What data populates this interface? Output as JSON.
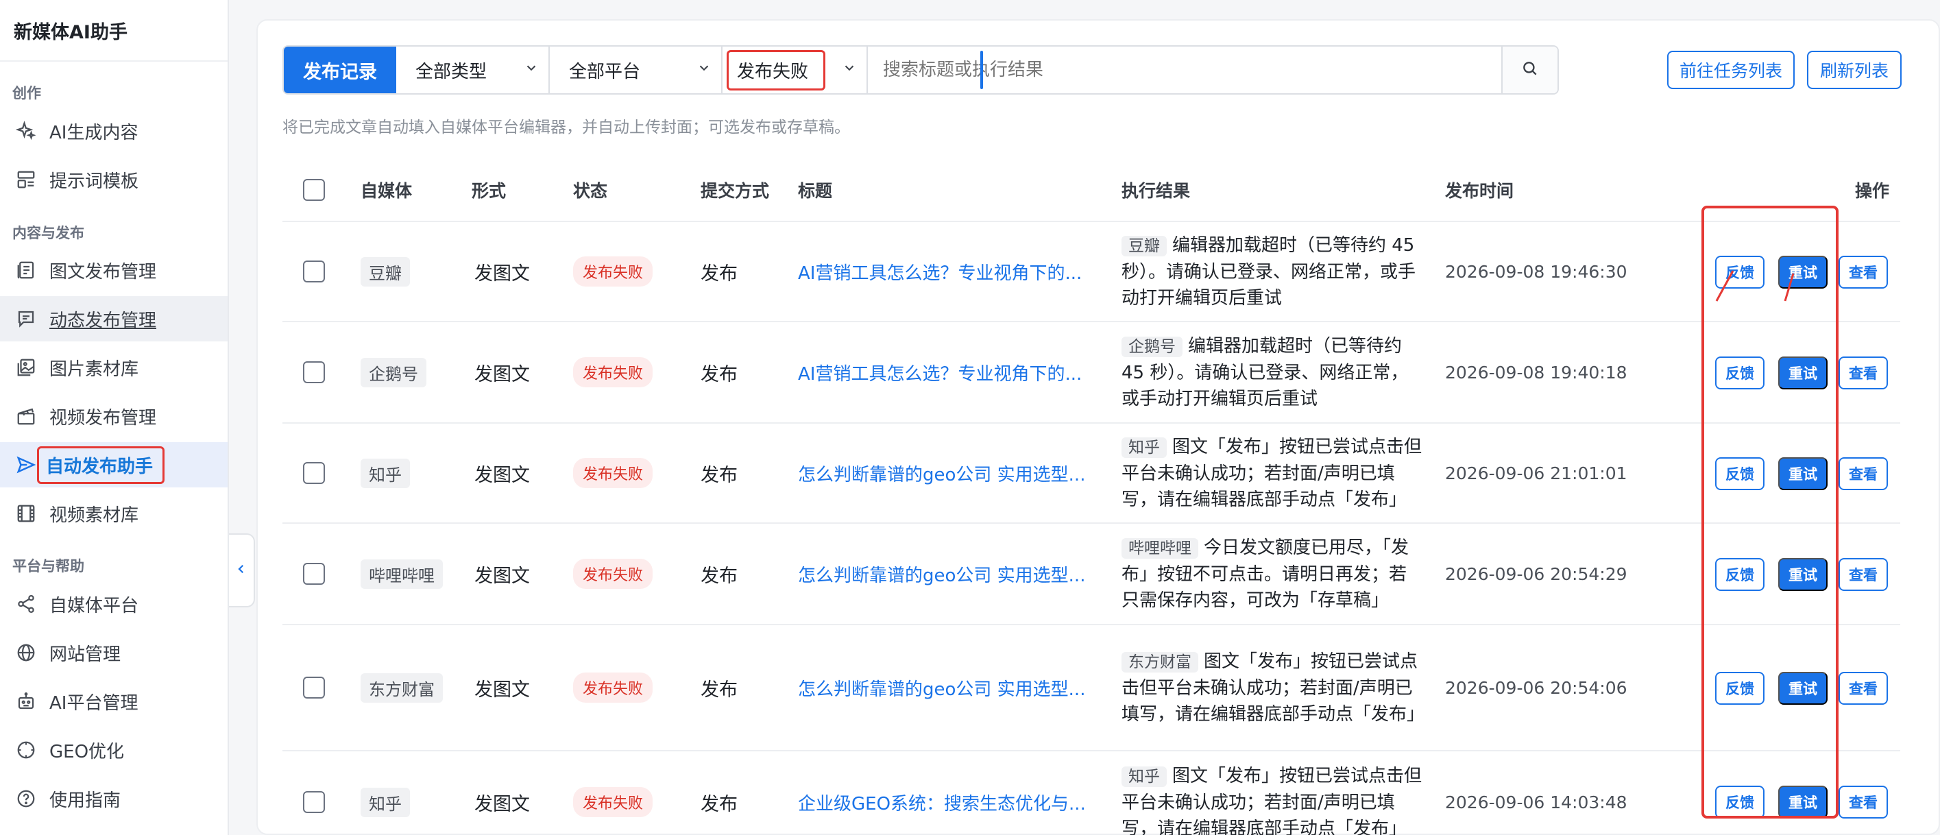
{
  "app": {
    "title": "新媒体AI助手"
  },
  "sidebar": {
    "groups": [
      {
        "title": "创作"
      },
      {
        "title": "内容与发布"
      },
      {
        "title": "平台与帮助"
      }
    ],
    "items": [
      {
        "label": "AI生成内容",
        "icon": "sparkle-icon"
      },
      {
        "label": "提示词模板",
        "icon": "template-icon"
      },
      {
        "label": "图文发布管理",
        "icon": "article-icon"
      },
      {
        "label": "动态发布管理",
        "icon": "message-icon"
      },
      {
        "label": "图片素材库",
        "icon": "image-icon"
      },
      {
        "label": "视频发布管理",
        "icon": "clapper-icon"
      },
      {
        "label": "自动发布助手",
        "icon": "send-icon"
      },
      {
        "label": "视频素材库",
        "icon": "film-icon"
      },
      {
        "label": "自媒体平台",
        "icon": "share-icon"
      },
      {
        "label": "网站管理",
        "icon": "globe-icon"
      },
      {
        "label": "AI平台管理",
        "icon": "robot-icon"
      },
      {
        "label": "GEO优化",
        "icon": "compass-icon"
      },
      {
        "label": "使用指南",
        "icon": "help-icon"
      }
    ]
  },
  "toolbar": {
    "label": "发布记录",
    "type_select": "全部类型",
    "platform_select": "全部平台",
    "status_select": "发布失败",
    "search_placeholder": "搜索标题或执行结果",
    "goto_tasks": "前往任务列表",
    "refresh": "刷新列表"
  },
  "hint": "将已完成文章自动填入自媒体平台编辑器，并自动上传封面；可选发布或存草稿。",
  "table": {
    "headers": {
      "media": "自媒体",
      "form": "形式",
      "status": "状态",
      "submit": "提交方式",
      "title": "标题",
      "result": "执行结果",
      "time": "发布时间",
      "ops": "操作"
    },
    "actions": {
      "feedback": "反馈",
      "retry": "重试",
      "view": "查看"
    },
    "rows": [
      {
        "media": "豆瓣",
        "form": "发图文",
        "status": "发布失败",
        "submit": "发布",
        "title": "AI营销工具怎么选？专业视角下的...",
        "result_tag": "豆瓣",
        "result": "编辑器加载超时（已等待约 45 秒）。请确认已登录、网络正常，或手动打开编辑页后重试",
        "time": "2026-09-08 19:46:30"
      },
      {
        "media": "企鹅号",
        "form": "发图文",
        "status": "发布失败",
        "submit": "发布",
        "title": "AI营销工具怎么选？专业视角下的...",
        "result_tag": "企鹅号",
        "result": "编辑器加载超时（已等待约 45 秒）。请确认已登录、网络正常，或手动打开编辑页后重试",
        "time": "2026-09-08 19:40:18"
      },
      {
        "media": "知乎",
        "form": "发图文",
        "status": "发布失败",
        "submit": "发布",
        "title": "怎么判断靠谱的geo公司 实用选型...",
        "result_tag": "知乎",
        "result": "图文「发布」按钮已尝试点击但平台未确认成功；若封面/声明已填写，请在编辑器底部手动点「发布」",
        "time": "2026-09-06 21:01:01"
      },
      {
        "media": "哔哩哔哩",
        "form": "发图文",
        "status": "发布失败",
        "submit": "发布",
        "title": "怎么判断靠谱的geo公司 实用选型...",
        "result_tag": "哔哩哔哩",
        "result": "今日发文额度已用尽，「发布」按钮不可点击。请明日再发；若只需保存内容，可改为「存草稿」",
        "time": "2026-09-06 20:54:29"
      },
      {
        "media": "东方财富",
        "form": "发图文",
        "status": "发布失败",
        "submit": "发布",
        "title": "怎么判断靠谱的geo公司 实用选型...",
        "result_tag": "东方财富",
        "result": "图文「发布」按钮已尝试点击但平台未确认成功；若封面/声明已填写，请在编辑器底部手动点「发布」",
        "time": "2026-09-06 20:54:06"
      },
      {
        "media": "知乎",
        "form": "发图文",
        "status": "发布失败",
        "submit": "发布",
        "title": "企业级GEO系统：搜索生态优化与...",
        "result_tag": "知乎",
        "result": "图文「发布」按钮已尝试点击但平台未确认成功；若封面/声明已填写，请在编辑器底部手动点「发布」",
        "time": "2026-09-06 14:03:48"
      }
    ]
  },
  "colors": {
    "accent": "#1a73e8",
    "danger": "#d93025",
    "highlight": "#e53935"
  }
}
